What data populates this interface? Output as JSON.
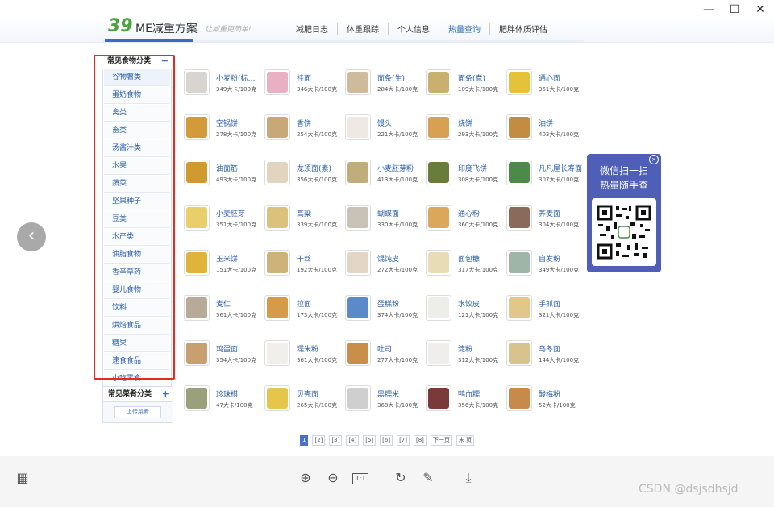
{
  "window": {
    "min_glyph": "—",
    "max_glyph": "☐",
    "close_glyph": "✕"
  },
  "header": {
    "logo_num": "39",
    "logo_text": "ME减重方案",
    "slogan": "让减重更简单!"
  },
  "nav": [
    "减肥日志",
    "体重跟踪",
    "个人信息",
    "热量查询",
    "肥胖体质评估"
  ],
  "nav_active_index": 3,
  "sidebar": {
    "title": "常见食物分类",
    "toggle": "−",
    "items": [
      "谷物薯类",
      "蛋奶食物",
      "禽类",
      "畜类",
      "汤酱汁类",
      "水果",
      "蔬菜",
      "坚果种子",
      "豆类",
      "水产类",
      "油脂食物",
      "香辛草药",
      "婴儿食物",
      "饮料",
      "烘焙食品",
      "糖果",
      "速食食品",
      "小吃零食"
    ],
    "dish_title": "常见菜肴分类",
    "dish_toggle": "+",
    "upload_label": "上传菜肴"
  },
  "foods": [
    {
      "name": "小麦粉(标…",
      "cal": "349大卡/100克",
      "color": "#d8d4cf"
    },
    {
      "name": "挂面",
      "cal": "346大卡/100克",
      "color": "#e9b0c4"
    },
    {
      "name": "面条(生)",
      "cal": "284大卡/100克",
      "color": "#cdbb9c"
    },
    {
      "name": "面条(煮)",
      "cal": "109大卡/100克",
      "color": "#c9b06e"
    },
    {
      "name": "通心面",
      "cal": "351大卡/100克",
      "color": "#e4c33a"
    },
    {
      "name": "空锅饼",
      "cal": "278大卡/100克",
      "color": "#d39a3a"
    },
    {
      "name": "香饼",
      "cal": "254大卡/100克",
      "color": "#c9a878"
    },
    {
      "name": "馒头",
      "cal": "221大卡/100克",
      "color": "#eeeae3"
    },
    {
      "name": "烧饼",
      "cal": "293大卡/100克",
      "color": "#d7a052"
    },
    {
      "name": "油饼",
      "cal": "403大卡/100克",
      "color": "#c48b42"
    },
    {
      "name": "油面筋",
      "cal": "493大卡/100克",
      "color": "#d19a2f"
    },
    {
      "name": "龙须面(素)",
      "cal": "356大卡/100克",
      "color": "#e2d5bf"
    },
    {
      "name": "小麦胚芽粉",
      "cal": "413大卡/100克",
      "color": "#bfae7c"
    },
    {
      "name": "印度飞饼",
      "cal": "308大卡/100克",
      "color": "#6a7c3a"
    },
    {
      "name": "凡凡屋长寿面",
      "cal": "307大卡/100克",
      "color": "#4d8a4a"
    },
    {
      "name": "小麦胚芽",
      "cal": "351大卡/100克",
      "color": "#e8cf6a"
    },
    {
      "name": "高粱",
      "cal": "339大卡/100克",
      "color": "#dcc17c"
    },
    {
      "name": "蝴蝶面",
      "cal": "330大卡/100克",
      "color": "#c9c2b6"
    },
    {
      "name": "通心粉",
      "cal": "360大卡/100克",
      "color": "#dba75a"
    },
    {
      "name": "荞麦面",
      "cal": "304大卡/100克",
      "color": "#8a6a5a"
    },
    {
      "name": "玉米饼",
      "cal": "151大卡/100克",
      "color": "#e0b43a"
    },
    {
      "name": "干丝",
      "cal": "192大卡/100克",
      "color": "#cdb27a"
    },
    {
      "name": "馄饨皮",
      "cal": "272大卡/100克",
      "color": "#e3d6c6"
    },
    {
      "name": "面包糠",
      "cal": "317大卡/100克",
      "color": "#e8dcb6"
    },
    {
      "name": "自发粉",
      "cal": "349大卡/100克",
      "color": "#9fb5a8"
    },
    {
      "name": "麦仁",
      "cal": "561大卡/100克",
      "color": "#b7aa98"
    },
    {
      "name": "拉面",
      "cal": "173大卡/100克",
      "color": "#d59a4a"
    },
    {
      "name": "蛋糕粉",
      "cal": "374大卡/100克",
      "color": "#5a8ac8"
    },
    {
      "name": "水饺皮",
      "cal": "121大卡/100克",
      "color": "#ededea"
    },
    {
      "name": "手抓面",
      "cal": "321大卡/100克",
      "color": "#e2c78a"
    },
    {
      "name": "鸡蛋面",
      "cal": "354大卡/100克",
      "color": "#c8a070"
    },
    {
      "name": "糯米粉",
      "cal": "361大卡/100克",
      "color": "#f0efec"
    },
    {
      "name": "吐司",
      "cal": "277大卡/100克",
      "color": "#c98f4a"
    },
    {
      "name": "淀粉",
      "cal": "312大卡/100克",
      "color": "#efeeed"
    },
    {
      "name": "乌冬面",
      "cal": "144大卡/100克",
      "color": "#d8c38f"
    },
    {
      "name": "珍珠棋",
      "cal": "47大卡/100克",
      "color": "#9aa07a"
    },
    {
      "name": "贝壳面",
      "cal": "265大卡/100克",
      "color": "#e6c64a"
    },
    {
      "name": "黑糯米",
      "cal": "368大卡/100克",
      "color": "#cfcfcf"
    },
    {
      "name": "鸭血糯",
      "cal": "356大卡/100克",
      "color": "#7a3a3a"
    },
    {
      "name": "酸梅粉",
      "cal": "52大卡/100克",
      "color": "#c88a4a"
    }
  ],
  "pager": [
    "1",
    "[2]",
    "[3]",
    "[4]",
    "[5]",
    "[6]",
    "[7]",
    "[8]",
    "下一页",
    "末 页"
  ],
  "qr": {
    "line1": "微信扫一扫",
    "line2": "热量随手查",
    "close": "×"
  },
  "toolbar": {
    "grid_icon": "▦",
    "zoom_in": "⊕",
    "zoom_out": "⊖",
    "actual_size": "1:1",
    "rotate": "↻",
    "edit": "✎",
    "download": "⤓"
  },
  "watermark": "CSDN @dsjsdhsjd",
  "prev_glyph": "‹"
}
